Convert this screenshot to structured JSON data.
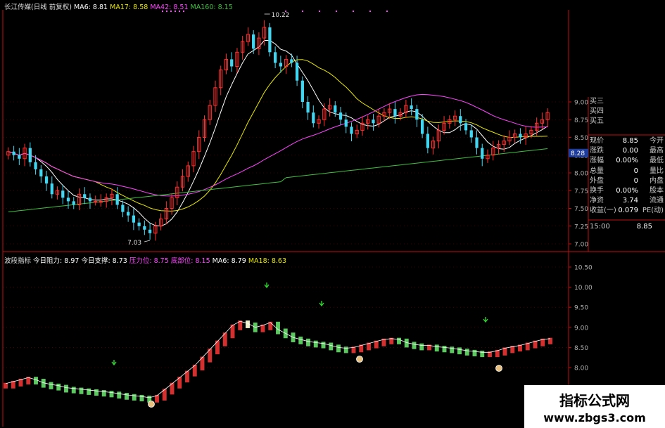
{
  "header": {
    "title": "长江传媒(日线 前复权)",
    "ma6": "MA6: 8.81",
    "ma17": "MA17: 8.58",
    "ma42": "MA42: 8.51",
    "ma160": "MA160: 8.15"
  },
  "sub_header": {
    "name": "波段指标",
    "resistance": "今日阻力: 8.97",
    "support": "今日支撑: 8.73",
    "pressure": "压力位: 8.75",
    "bottom": "底部位: 8.15",
    "ma6": "MA6: 8.79",
    "ma18": "MA18: 8.63"
  },
  "annotations": {
    "high": "10.22",
    "low": "7.03",
    "current_tag": "8.28"
  },
  "price_axis": [
    "9.00",
    "8.75",
    "8.50",
    "8.25",
    "8.00",
    "7.75",
    "7.50",
    "7.25",
    "7.00"
  ],
  "ind_axis": [
    "10.50",
    "10.00",
    "9.50",
    "9.00",
    "8.50",
    "8.00"
  ],
  "panel": {
    "orders": [
      "买三",
      "买四",
      "买五"
    ],
    "quotes": [
      {
        "l": "现价",
        "v": "8.85",
        "r": "今开"
      },
      {
        "l": "涨跌",
        "v": "0.00",
        "r": "最高"
      },
      {
        "l": "涨幅",
        "v": "0.00%",
        "r": "最低"
      },
      {
        "l": "总量",
        "v": "0",
        "r": "量比"
      },
      {
        "l": "外盘",
        "v": "0",
        "r": "内盘"
      },
      {
        "l": "换手",
        "v": "0.00%",
        "r": "股本"
      },
      {
        "l": "净资",
        "v": "3.74",
        "r": "流通"
      },
      {
        "l": "收益(一)",
        "v": "0.079",
        "r": "PE(动)"
      }
    ],
    "time": "15:00",
    "time_price": "8.85"
  },
  "brand": {
    "name": "指标公式网",
    "url": "www.zbgs3.com"
  },
  "colors": {
    "up": "#ff3030",
    "down": "#44d6f0",
    "ma6": "#ffffff",
    "ma17": "#e8e800",
    "ma42": "#ff44ff",
    "ma160": "#40c040",
    "grid": "#7a0000",
    "axis": "#c01010",
    "band_up": "#d43030",
    "band_down": "#5cc860",
    "band_peak": "#f0f0c8"
  },
  "chart_data": [
    {
      "type": "candlestick",
      "title": "长江传媒(日线 前复权)",
      "ylim": [
        7.0,
        9.0
      ],
      "annotated_high": 10.22,
      "annotated_low": 7.03,
      "closes": [
        8.3,
        8.25,
        8.2,
        8.35,
        8.15,
        8.05,
        7.95,
        7.85,
        7.7,
        7.75,
        7.65,
        7.6,
        7.55,
        7.7,
        7.65,
        7.6,
        7.6,
        7.6,
        7.65,
        7.7,
        7.55,
        7.45,
        7.4,
        7.3,
        7.25,
        7.2,
        7.15,
        7.25,
        7.35,
        7.5,
        7.65,
        7.8,
        7.95,
        8.1,
        8.3,
        8.5,
        8.75,
        8.95,
        9.2,
        9.45,
        9.6,
        9.5,
        9.7,
        9.85,
        9.95,
        9.75,
        9.9,
        10.05,
        9.7,
        9.55,
        9.5,
        9.6,
        9.55,
        9.3,
        9.0,
        8.85,
        8.7,
        8.75,
        8.9,
        8.95,
        8.85,
        8.75,
        8.65,
        8.55,
        8.6,
        8.7,
        8.75,
        8.7,
        8.8,
        8.85,
        8.9,
        8.8,
        8.85,
        8.95,
        8.9,
        8.75,
        8.55,
        8.35,
        8.45,
        8.6,
        8.7,
        8.75,
        8.8,
        8.7,
        8.6,
        8.5,
        8.35,
        8.2,
        8.25,
        8.35,
        8.4,
        8.45,
        8.5,
        8.55,
        8.5,
        8.55,
        8.6,
        8.7,
        8.75,
        8.85
      ]
    },
    {
      "type": "area",
      "title": "波段指标",
      "ylim": [
        7.5,
        10.75
      ],
      "values": [
        7.6,
        7.65,
        7.7,
        7.75,
        7.7,
        7.62,
        7.58,
        7.55,
        7.5,
        7.48,
        7.46,
        7.44,
        7.42,
        7.4,
        7.38,
        7.35,
        7.32,
        7.3,
        7.28,
        7.25,
        7.3,
        7.45,
        7.6,
        7.75,
        7.9,
        8.05,
        8.25,
        8.45,
        8.65,
        8.85,
        9.05,
        9.15,
        9.1,
        9.0,
        9.05,
        9.12,
        8.95,
        8.85,
        8.75,
        8.7,
        8.65,
        8.62,
        8.6,
        8.55,
        8.5,
        8.48,
        8.5,
        8.55,
        8.6,
        8.65,
        8.7,
        8.72,
        8.7,
        8.62,
        8.58,
        8.55,
        8.55,
        8.52,
        8.5,
        8.48,
        8.45,
        8.42,
        8.4,
        8.38,
        8.38,
        8.42,
        8.48,
        8.52,
        8.55,
        8.6,
        8.65,
        8.7,
        8.72
      ]
    }
  ]
}
